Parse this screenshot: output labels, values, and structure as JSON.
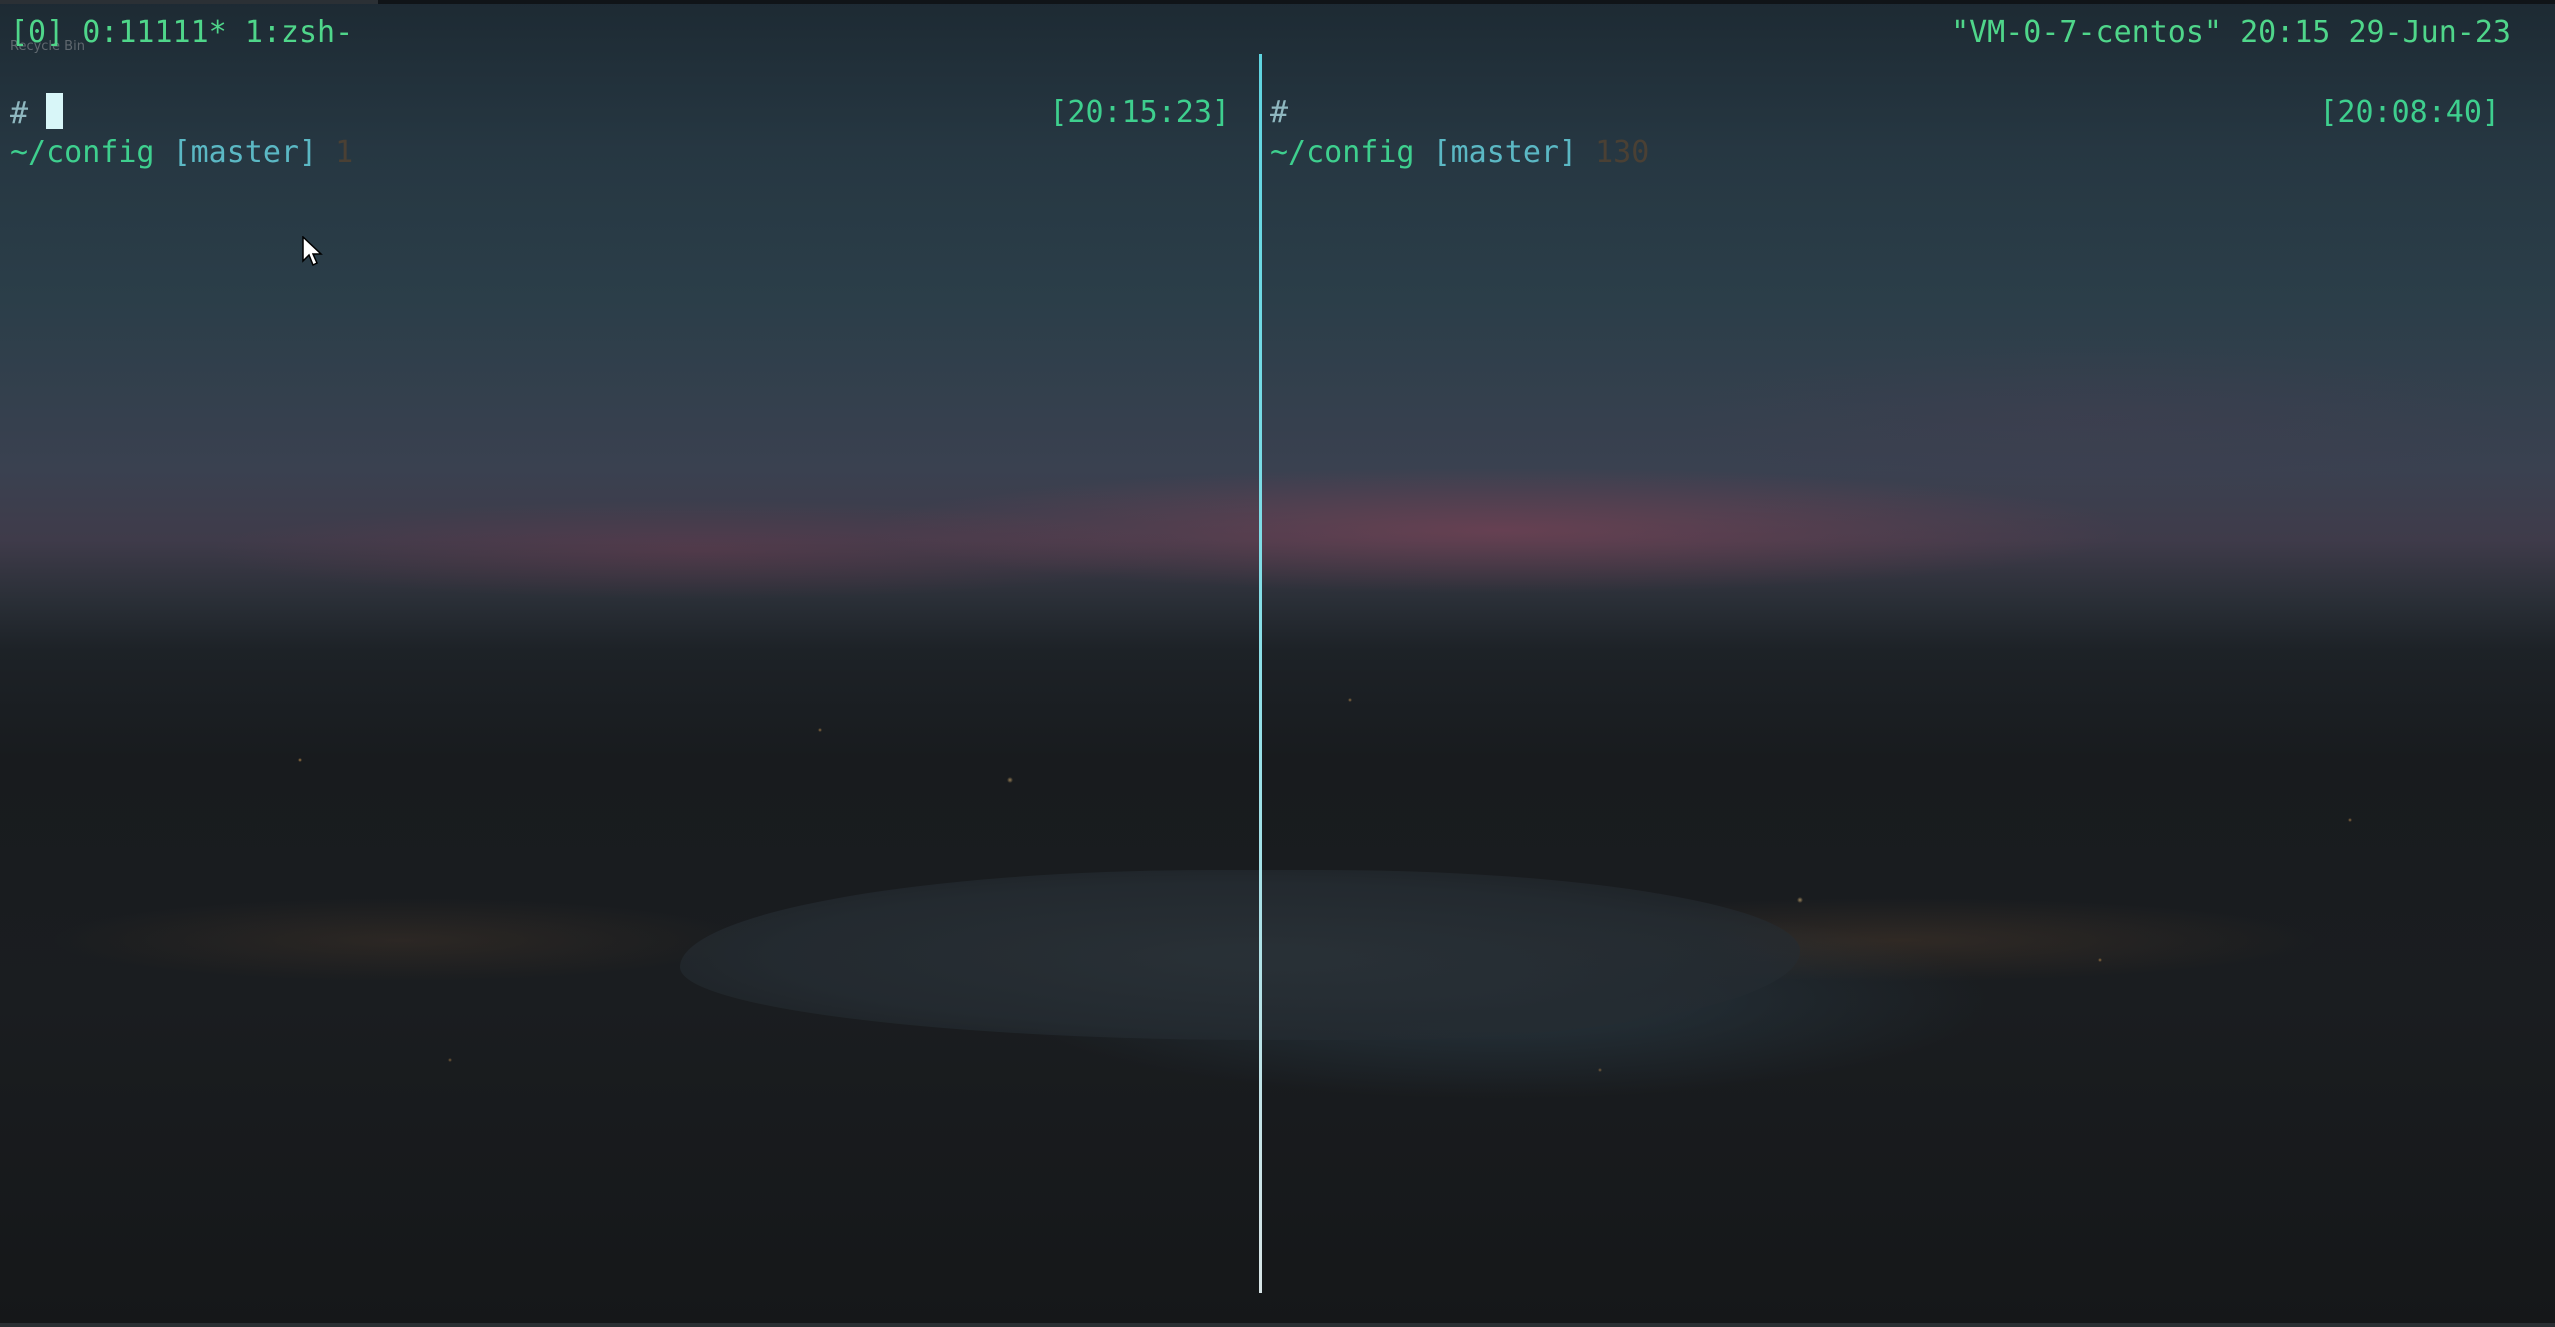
{
  "tmux": {
    "session": "[0]",
    "window_0": "0:11111*",
    "window_1": "1:zsh-",
    "host": "\"VM-0-7-centos\"",
    "time": "20:15",
    "date": "29-Jun-23"
  },
  "overlay_text": "Recycle Bin",
  "panes": [
    {
      "path": "~/config",
      "branch": "[master]",
      "exit_code": "1",
      "prompt": "#",
      "timestamp": "[20:15:23]"
    },
    {
      "path": "~/config",
      "branch": "[master]",
      "exit_code": "130",
      "prompt": "#",
      "timestamp": "[20:08:40]"
    }
  ],
  "colors": {
    "status_green": "#4fd68a",
    "path_green": "#3ecf8e",
    "branch_cyan": "#5bb8c4",
    "active_border": "#5fd4e0",
    "cursor": "#d8f6f8"
  },
  "icons": {
    "mouse": "mouse-pointer-icon"
  }
}
